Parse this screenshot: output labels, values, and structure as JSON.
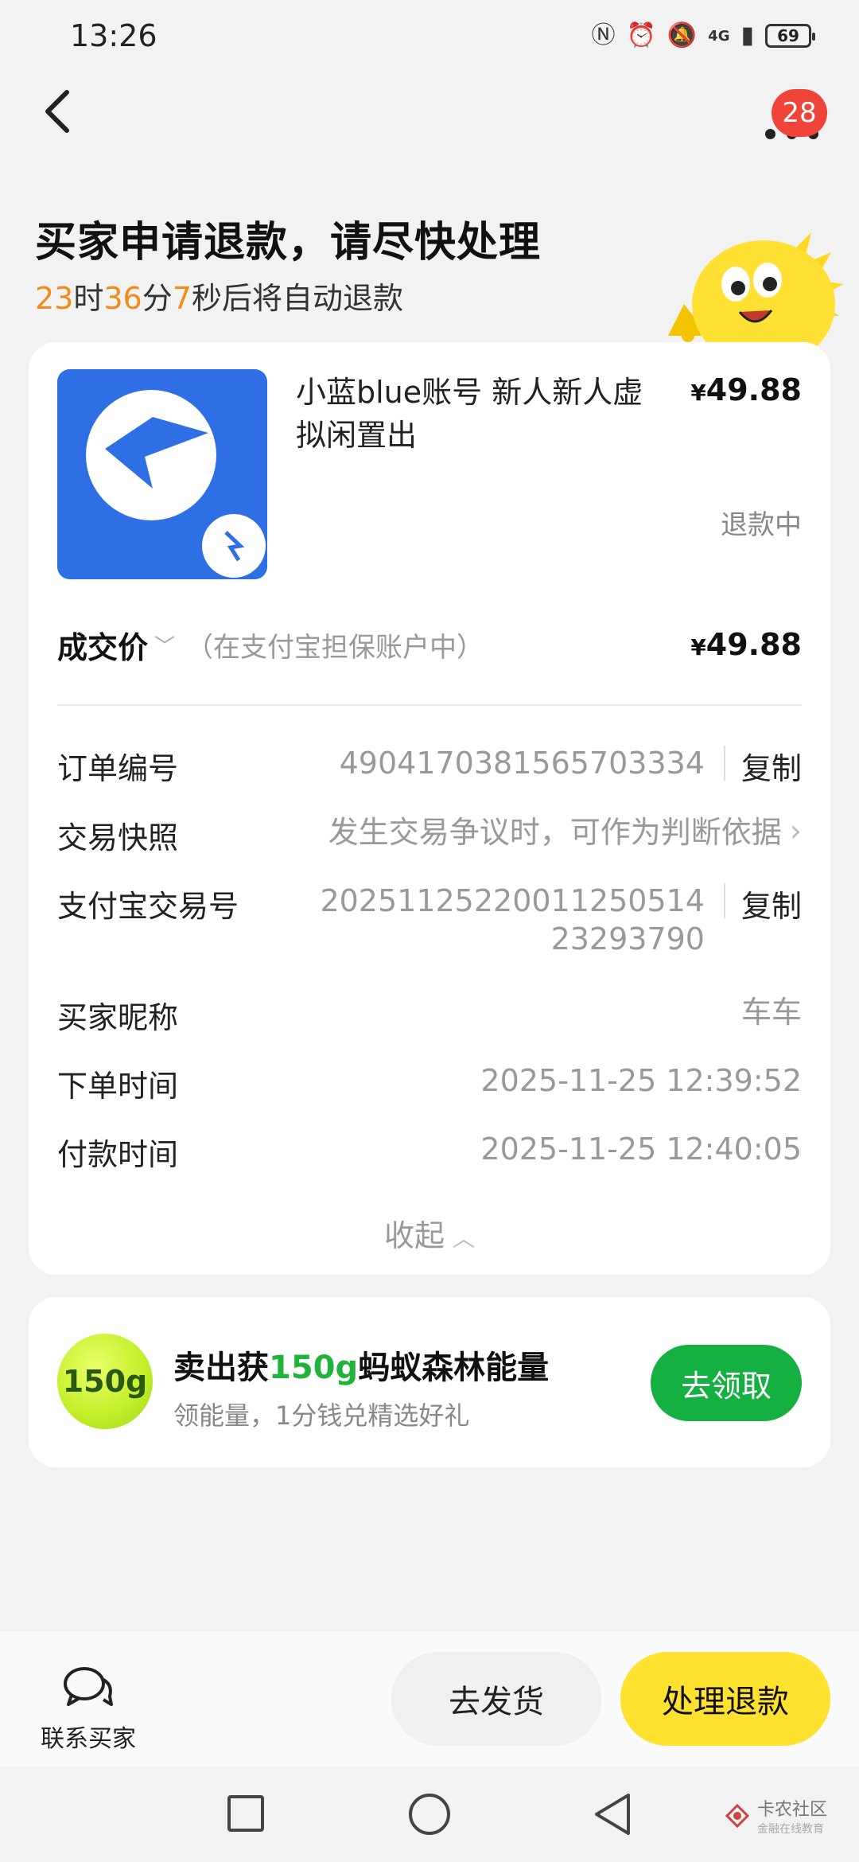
{
  "status_bar": {
    "time": "13:26",
    "network": "4G",
    "battery": "69"
  },
  "nav": {
    "badge_count": "28"
  },
  "header": {
    "title": "买家申请退款，请尽快处理",
    "countdown": {
      "hours": "23",
      "hours_unit": "时",
      "minutes": "36",
      "minutes_unit": "分",
      "seconds": "7",
      "seconds_suffix": "秒后将自动退款"
    }
  },
  "product": {
    "title": "小蓝blue账号 新人新人虚拟闲置出",
    "price_symbol": "¥",
    "price": "49.88",
    "status": "退款中"
  },
  "deal": {
    "label": "成交价",
    "note": "（在支付宝担保账户中）",
    "price_symbol": "¥",
    "price": "49.88"
  },
  "details": {
    "order_no_label": "订单编号",
    "order_no": "4904170381565703334",
    "copy_label": "复制",
    "snapshot_label": "交易快照",
    "snapshot_value": "发生交易争议时，可作为判断依据",
    "alipay_no_label": "支付宝交易号",
    "alipay_no_line1": "20251125220011250514",
    "alipay_no_line2": "23293790",
    "buyer_label": "买家昵称",
    "buyer_value": "车车",
    "order_time_label": "下单时间",
    "order_time_value": "2025-11-25 12:39:52",
    "pay_time_label": "付款时间",
    "pay_time_value": "2025-11-25 12:40:05",
    "collapse_label": "收起"
  },
  "energy": {
    "ball_label": "150g",
    "title_prefix": "卖出获",
    "title_highlight": "150g",
    "title_suffix": "蚂蚁森林能量",
    "subtitle": "领能量，1分钱兑精选好礼",
    "button": "去领取"
  },
  "bottom": {
    "contact_label": "联系买家",
    "ship_label": "去发货",
    "refund_label": "处理退款"
  },
  "watermark": {
    "main": "卡农社区",
    "sub": "金融在线教育"
  },
  "colors": {
    "accent_orange": "#f28a1c",
    "badge_red": "#f0433a",
    "energy_green": "#15b042",
    "refund_yellow": "#ffe22f"
  }
}
